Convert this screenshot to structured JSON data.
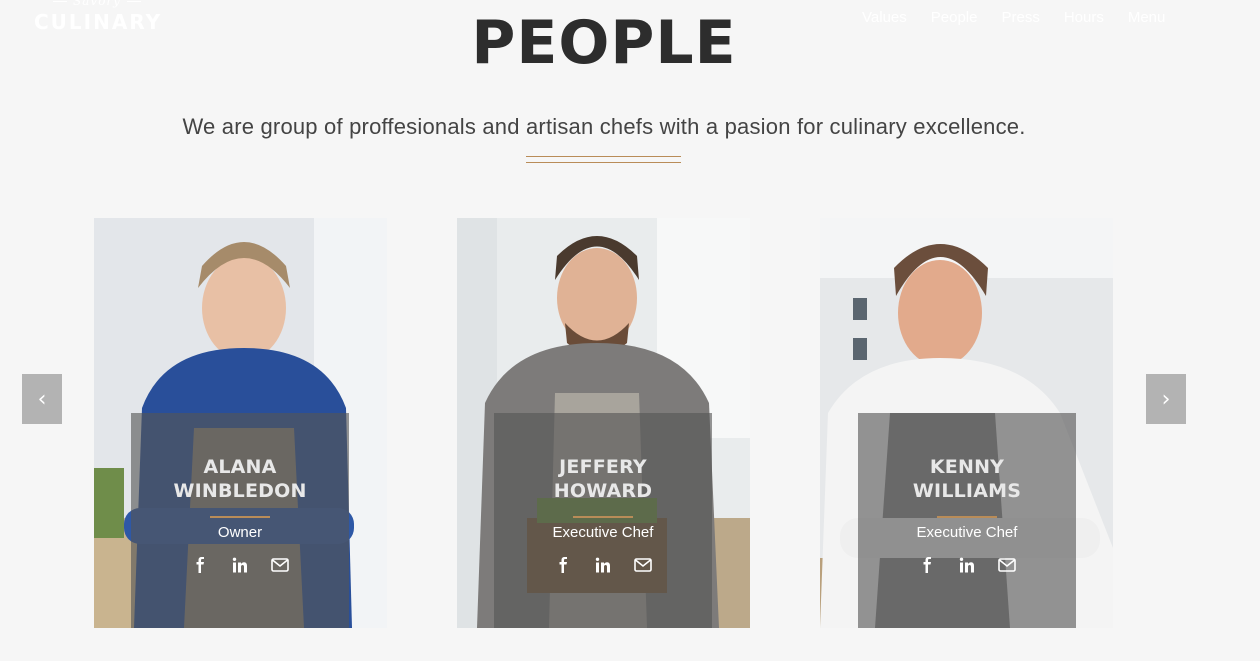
{
  "brand": {
    "tagline": "Savory",
    "name": "CULINARY"
  },
  "nav": [
    "Values",
    "People",
    "Press",
    "Hours",
    "Menu"
  ],
  "section": {
    "title": "PEOPLE",
    "subtitle": "We are group of proffesionals and artisan chefs with a pasion for culinary excellence."
  },
  "carousel": {
    "prev_icon": "‹",
    "next_icon": "›"
  },
  "team": [
    {
      "name_line1": "ALANA",
      "name_line2": "WINBLEDON",
      "role": "Owner"
    },
    {
      "name_line1": "JEFFERY",
      "name_line2": "HOWARD",
      "role": "Executive Chef"
    },
    {
      "name_line1": "KENNY",
      "name_line2": "WILLIAMS",
      "role": "Executive Chef"
    }
  ],
  "social_icons": [
    "facebook-icon",
    "linkedin-icon",
    "envelope-icon"
  ],
  "colors": {
    "accent": "#b98c58",
    "background": "#f6f6f6",
    "overlay": "#555555",
    "arrow": "#b3b3b3"
  }
}
